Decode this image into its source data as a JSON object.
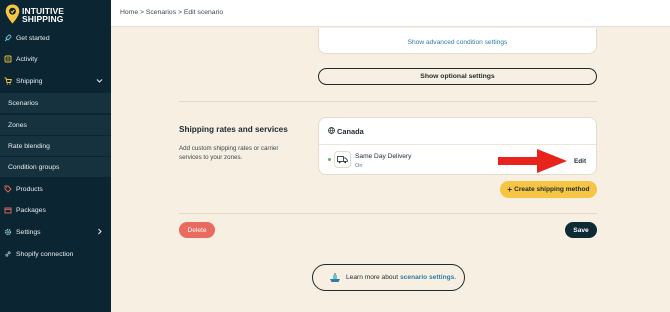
{
  "brand": {
    "line1": "INTUITIVE",
    "line2": "SHIPPING"
  },
  "nav": {
    "get_started": "Get started",
    "activity": "Activity",
    "shipping": "Shipping",
    "scenarios": "Scenarios",
    "zones": "Zones",
    "rate_blending": "Rate blending",
    "condition_groups": "Condition groups",
    "products": "Products",
    "packages": "Packages",
    "settings": "Settings",
    "shopify_connection": "Shopify connection"
  },
  "breadcrumb": "Home > Scenarios > Edit scenario",
  "advanced_link": "Show advanced condition settings",
  "optional_button": "Show optional settings",
  "section": {
    "title": "Shipping rates and services",
    "description": "Add custom shipping rates or carrier services to your zones."
  },
  "card": {
    "country": "Canada",
    "method_name": "Same Day Delivery",
    "method_status": "On",
    "edit": "Edit"
  },
  "create_button": "Create shipping method",
  "delete_button": "Delete",
  "save_button": "Save",
  "learn": {
    "prefix": "Learn more about",
    "link": "scenario settings",
    "suffix": "."
  },
  "colors": {
    "sidebar": "#0b2632",
    "accent_yellow": "#f6c543",
    "delete_red": "#e96a5e",
    "arrow_red": "#e8231c",
    "link_blue": "#2f7ca6"
  }
}
